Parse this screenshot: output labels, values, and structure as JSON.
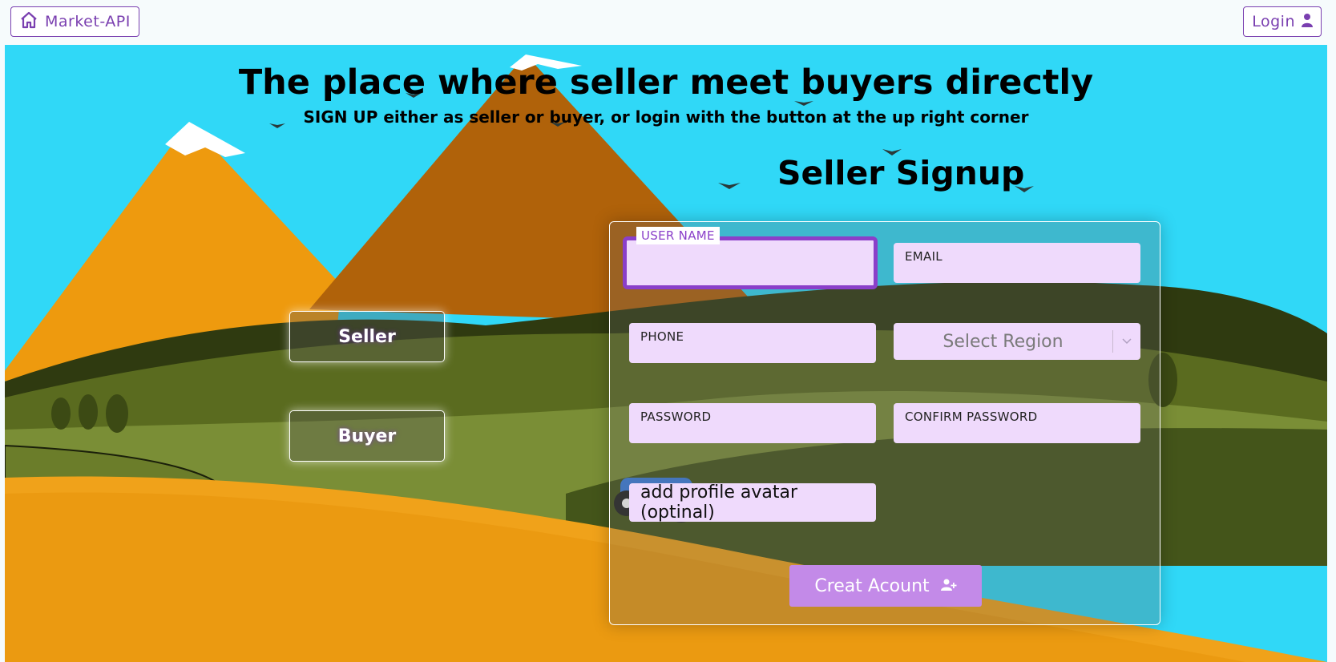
{
  "navbar": {
    "home_label": "Market-API",
    "login_label": "Login"
  },
  "hero": {
    "title": "The place where seller meet buyers directly",
    "subtitle": "SIGN UP either as seller or buyer, or login with the button at the up right corner"
  },
  "signup": {
    "title": "Seller Signup"
  },
  "roles": {
    "seller_label": "Seller",
    "buyer_label": "Buyer"
  },
  "form": {
    "username_label": "USER NAME",
    "email_label": "EMAIL",
    "phone_label": "PHONE",
    "region_placeholder": "Select Region",
    "password_label": "PASSWORD",
    "confirm_password_label": "CONFIRM PASSWORD",
    "avatar_label": "add profile avatar (optinal)",
    "submit_label": "Creat Acount"
  },
  "colors": {
    "accent": "#8a3fc9",
    "field_bg": "#efdafc",
    "button_bg": "#c38ae8",
    "sky": "#30d8f7"
  },
  "icons": {
    "home": "home-icon",
    "login": "user-icon",
    "submit": "user-plus-icon",
    "region": "chevron-down-icon"
  }
}
